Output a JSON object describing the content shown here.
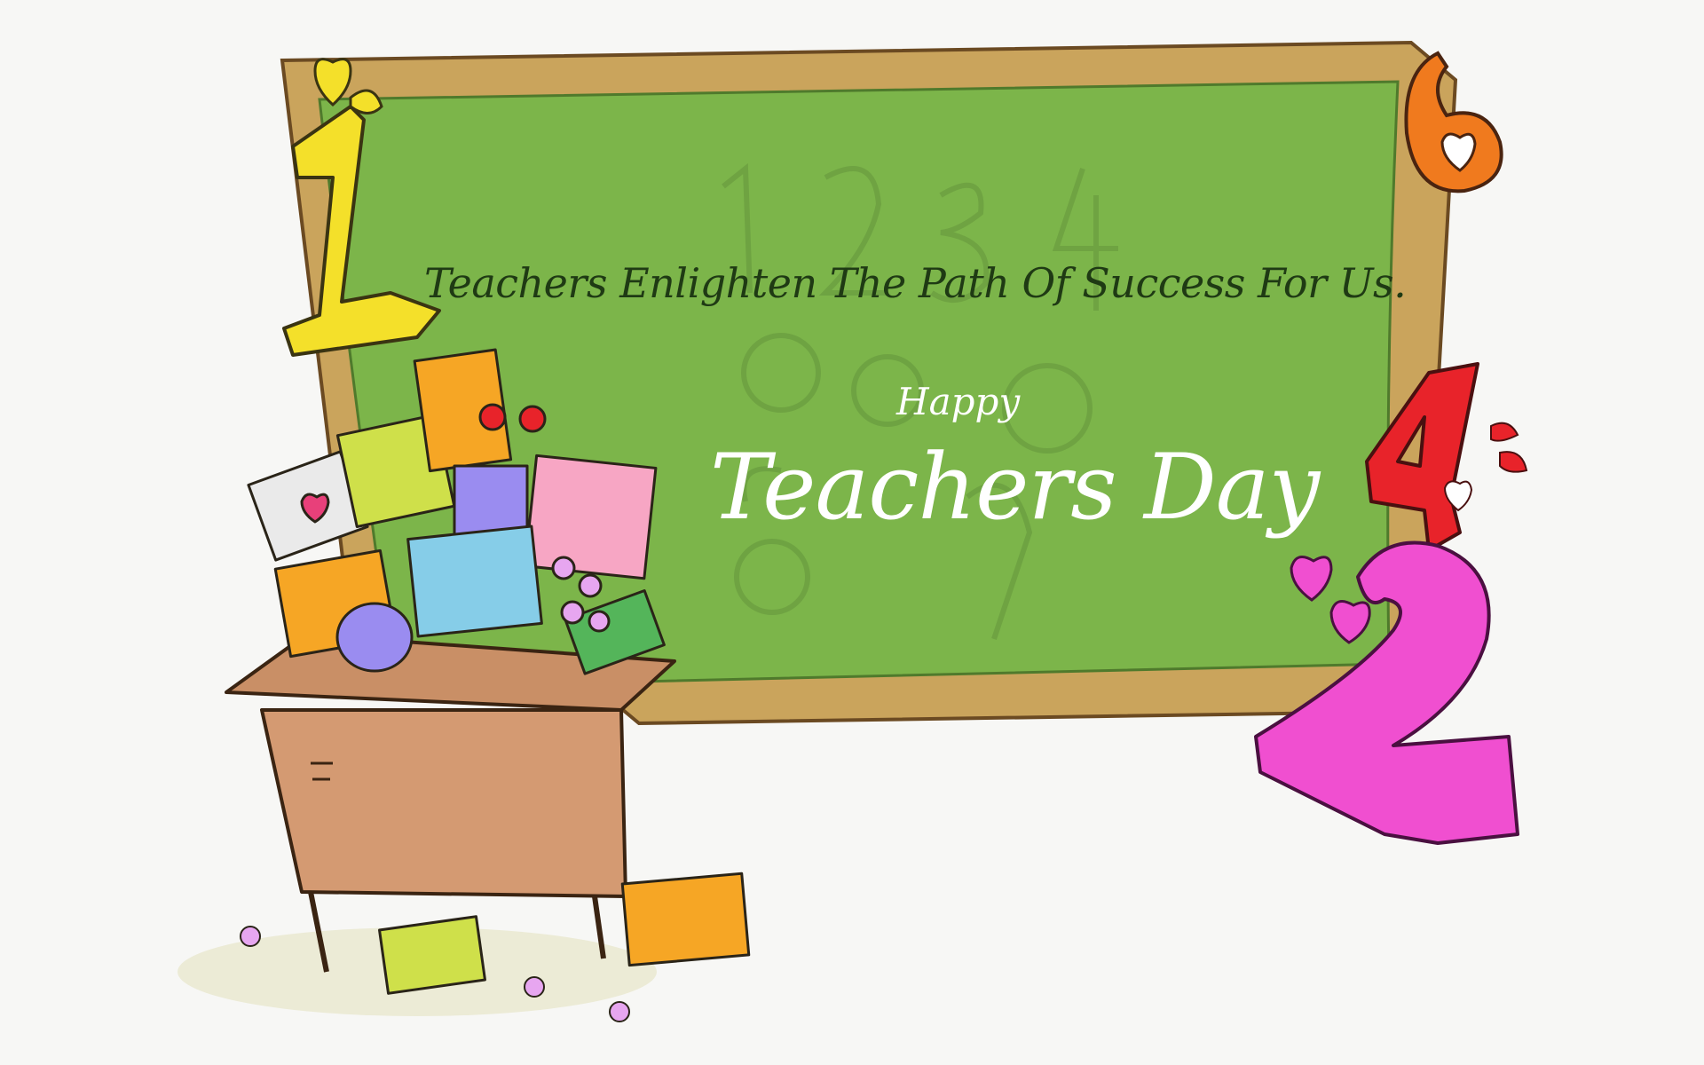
{
  "card": {
    "tagline": "Teachers Enlighten The Path Of Success For Us.",
    "greeting_small": "Happy",
    "greeting_large": "Teachers Day",
    "decor_numbers": {
      "one": "1",
      "two": "2",
      "four": "4",
      "six": "6"
    }
  },
  "colors": {
    "background": "#f7f7f5",
    "board_green": "#7cb54a",
    "board_frame": "#c9a35a",
    "tagline_text": "#1f3a14",
    "greeting_text": "#ffffff",
    "number_one": "#f4e02a",
    "number_two": "#f04fd0",
    "number_four": "#e8232a",
    "number_six": "#f07a1e",
    "desk": "#d49a72"
  },
  "icons": [
    "blackboard",
    "gift-pile",
    "desk",
    "flower",
    "heart"
  ]
}
